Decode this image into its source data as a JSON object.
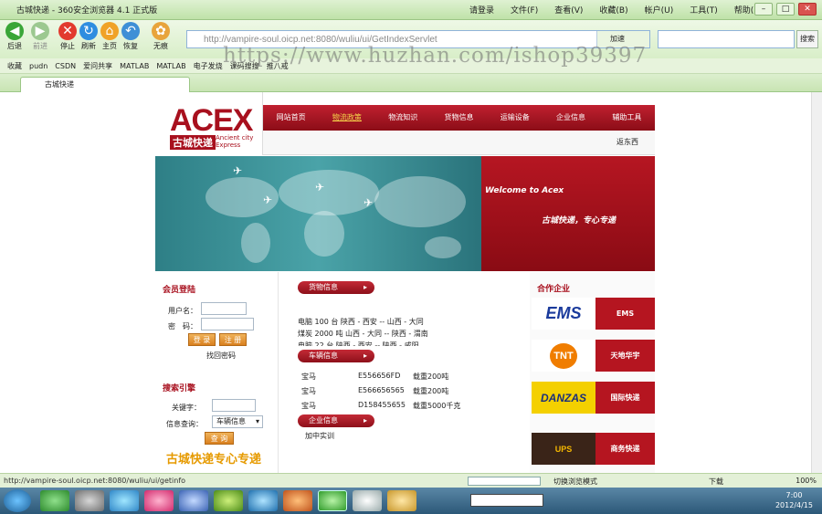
{
  "browser": {
    "title": "古城快递 - 360安全浏览器 4.1 正式版",
    "menus": [
      "请登录",
      "文件(F)",
      "查看(V)",
      "收藏(B)",
      "帐户(U)",
      "工具(T)",
      "帮助(H)"
    ],
    "nav_buttons": [
      "后退",
      "前进",
      "停止",
      "刷新",
      "主页",
      "恢复",
      "无痕"
    ],
    "address": "http://vampire-soul.oicp.net:8080/wuliu/ui/GetIndexServlet",
    "accel_label": "加速",
    "search_label": "搜索",
    "favorites": [
      "收藏",
      "pudn",
      "CSDN",
      "爱问共享",
      "MATLAB",
      "MATLAB",
      "电子发烧",
      "课码搜搜",
      "推八戒"
    ],
    "tab_title": "古城快递",
    "watermark": "https://www.huzhan.com/ishop39397"
  },
  "site": {
    "logo_text": "ACEX",
    "logo_cn": "古城快递",
    "logo_en_1": "Ancient city",
    "logo_en_2": "Express",
    "nav": [
      "网站首页",
      "物流政策",
      "物流知识",
      "货物信息",
      "运输设备",
      "企业信息",
      "辅助工具"
    ],
    "subnav": "返东西",
    "banner_welcome": "Welcome to Acex",
    "banner_slogan": "古城快递，专心专递",
    "login": {
      "title": "会员登陆",
      "user_label": "用户名：",
      "pass_label": "密　码：",
      "login_btn": "登 录",
      "register_btn": "注 册",
      "forgot": "找回密码"
    },
    "search": {
      "title": "搜索引擎",
      "keyword_label": "关键字：",
      "info_label": "信息查询：",
      "select_value": "车辆信息",
      "query_btn": "查 询"
    },
    "promo": "古城快递专心专递",
    "goods": {
      "title": "货物信息",
      "lines": [
        "电脑 100 台 陕西 - 西安 -- 山西 - 大同",
        "煤炭 2000 吨 山西 - 大同 -- 陕西 - 渭南",
        "电脑 22 台 陕西 - 西安 -- 陕西 - 咸阳"
      ]
    },
    "vehicles": {
      "title": "车辆信息",
      "rows": [
        {
          "brand": "宝马",
          "plate": "E556656FD",
          "load": "载重200吨"
        },
        {
          "brand": "宝马",
          "plate": "E566656565",
          "load": "载重200吨"
        },
        {
          "brand": "宝马",
          "plate": "D158455655",
          "load": "载重5000千克"
        }
      ]
    },
    "enterprise": {
      "title": "企业信息",
      "item": "加中实训"
    },
    "partners": {
      "title": "合作企业",
      "items": [
        {
          "logo": "EMS",
          "name": "EMS"
        },
        {
          "logo": "TNT",
          "name": "天地华宇"
        },
        {
          "logo": "DANZAS",
          "name": "国际快递"
        },
        {
          "logo": "UPS",
          "name": "商务快递"
        }
      ]
    }
  },
  "status": {
    "url": "http://vampire-soul.oicp.net:8080/wuliu/ui/getinfo",
    "mode": "切换浏览模式",
    "download": "下载",
    "zoom": "100%"
  },
  "taskbar": {
    "time": "7:00",
    "date": "2012/4/15"
  }
}
